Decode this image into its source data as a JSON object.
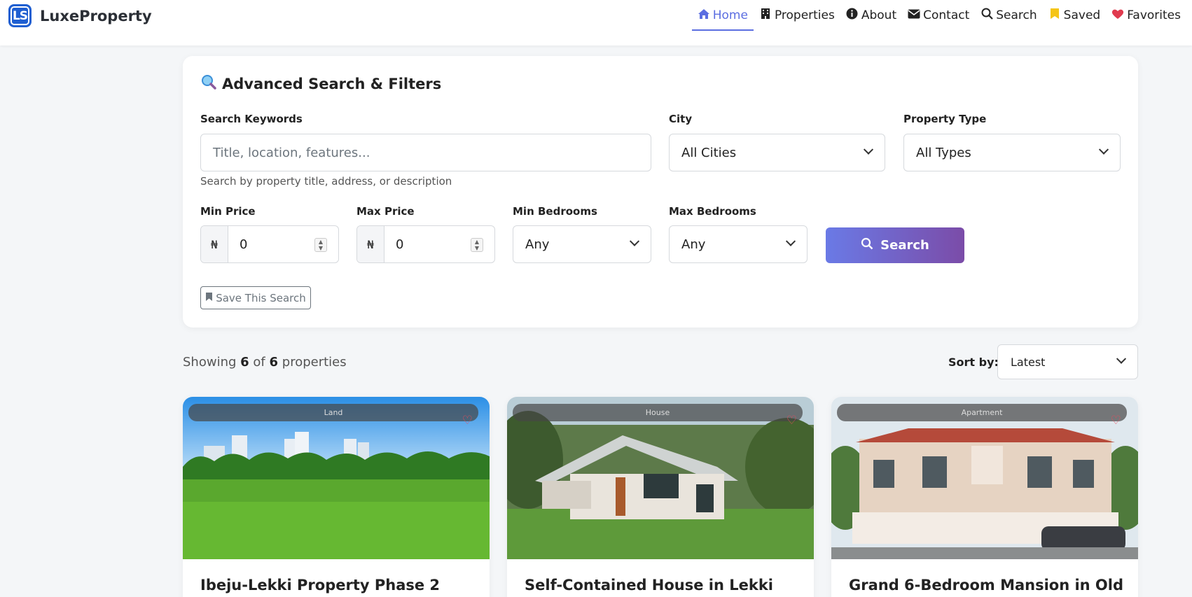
{
  "brand": {
    "logo_text": "LS",
    "name": "LuxeProperty"
  },
  "nav": [
    {
      "label": "Home",
      "icon": "home-icon",
      "active": true
    },
    {
      "label": "Properties",
      "icon": "building-icon",
      "active": false
    },
    {
      "label": "About",
      "icon": "info-icon",
      "active": false
    },
    {
      "label": "Contact",
      "icon": "envelope-icon",
      "active": false
    },
    {
      "label": "Search",
      "icon": "search-icon",
      "active": false
    },
    {
      "label": "Saved",
      "icon": "bookmark-icon",
      "active": false
    },
    {
      "label": "Favorites",
      "icon": "heart-icon",
      "active": false
    }
  ],
  "search_card": {
    "title": "Advanced Search & Filters",
    "keywords_label": "Search Keywords",
    "keywords_placeholder": "Title, location, features...",
    "keywords_help": "Search by property title, address, or description",
    "city_label": "City",
    "city_value": "All Cities",
    "type_label": "Property Type",
    "type_value": "All Types",
    "min_price_label": "Min Price",
    "min_price_value": "0",
    "max_price_label": "Max Price",
    "max_price_value": "0",
    "currency_symbol": "₦",
    "min_bed_label": "Min Bedrooms",
    "min_bed_value": "Any",
    "max_bed_label": "Max Bedrooms",
    "max_bed_value": "Any",
    "search_button": "Search",
    "save_button": "Save This Search"
  },
  "results": {
    "showing_prefix": "Showing",
    "shown": "6",
    "of": "of",
    "total": "6",
    "suffix": "properties",
    "sort_label": "Sort by:",
    "sort_value": "Latest"
  },
  "properties": [
    {
      "badge": "Land",
      "title": "Ibeju-Lekki Property Phase 2"
    },
    {
      "badge": "House",
      "title": "Self-Contained House in Lekki"
    },
    {
      "badge": "Apartment",
      "title": "Grand 6-Bedroom Mansion in Old"
    }
  ],
  "colors": {
    "accent": "#5b6ee1",
    "brand": "#1f5fd1",
    "heart": "#e84b5c"
  }
}
